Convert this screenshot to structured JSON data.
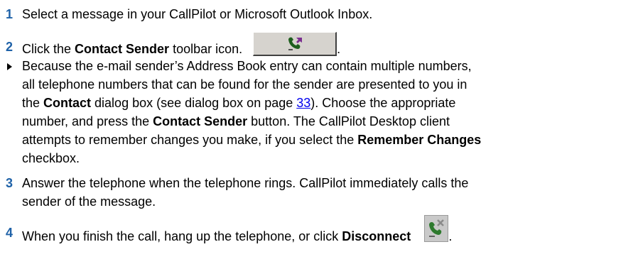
{
  "steps": [
    {
      "num": "1",
      "text": "Select a message in your CallPilot or Microsoft Outlook Inbox."
    },
    {
      "num": "2",
      "pre": "Click the ",
      "bold": "Contact Sender",
      "post": " toolbar icon.",
      "after_icon": "."
    },
    {
      "num": "3",
      "line1": "Answer the telephone when the telephone rings. CallPilot immediately calls the",
      "line2": "sender of the message."
    },
    {
      "num": "4",
      "pre": "When you finish the call, hang up the telephone, or click ",
      "bold": "Disconnect",
      "after_icon": "."
    }
  ],
  "bullet": {
    "l1": "Because the e-mail sender’s  Address Book entry can contain multiple numbers,",
    "l2": "all telephone numbers that can be found for the sender are presented to you in",
    "l3_pre": "the ",
    "l3_bold": "Contact",
    "l3_mid": " dialog box (see dialog box on page ",
    "l3_link": "33",
    "l3_post": "). Choose the appropriate",
    "l4_pre": "number, and press the ",
    "l4_bold": "Contact Sender",
    "l4_post": " button. The CallPilot Desktop client",
    "l5_pre": "attempts to remember changes you make, if you select the ",
    "l5_bold": "Remember Changes",
    "l6": "checkbox."
  },
  "icons": {
    "contact_sender": "contact-sender-phone-icon",
    "disconnect": "disconnect-phone-icon"
  },
  "colors": {
    "step_number": "#1f62a8",
    "link": "#0000ee"
  }
}
